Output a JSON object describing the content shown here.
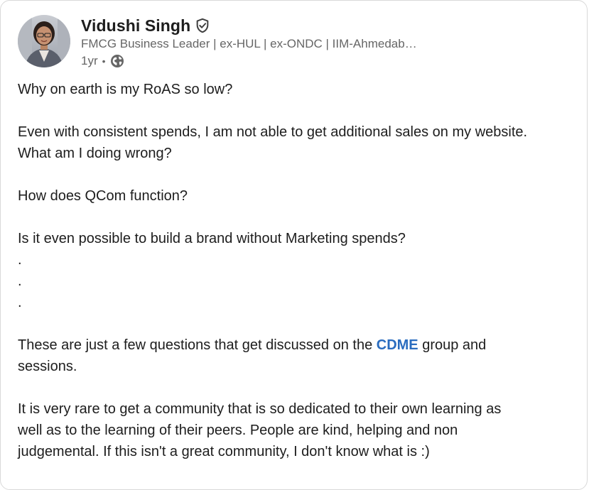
{
  "author": {
    "name": "Vidushi Singh",
    "headline": "FMCG Business Leader | ex-HUL | ex-ONDC | IIM-Ahmedab…",
    "time_ago": "1yr",
    "separator": "•",
    "verified_icon": "verified-shield-icon",
    "visibility_icon": "globe-icon"
  },
  "post": {
    "line1": "Why on earth is my RoAS so low?",
    "line2": "Even with consistent spends, I am not able to get additional sales on my website.",
    "line3": "What am I doing wrong?",
    "line4": "How does QCom function?",
    "line5": "Is it even possible to build a brand without Marketing spends?",
    "dot1": ".",
    "dot2": ".",
    "dot3": ".",
    "line6_pre": "These are just a few questions that get discussed on the ",
    "line6_link": "CDME",
    "line6_post": " group and",
    "line7": "sessions.",
    "line8": "It is very rare to get a community that is so dedicated to their own learning as",
    "line9": "well as to the learning of their peers. People are kind, helping and non",
    "line10": "judgemental. If this isn't a great community, I don't know what is :)"
  },
  "colors": {
    "link": "#2a6cbf",
    "text": "#1d1d1d",
    "muted": "#666666"
  }
}
